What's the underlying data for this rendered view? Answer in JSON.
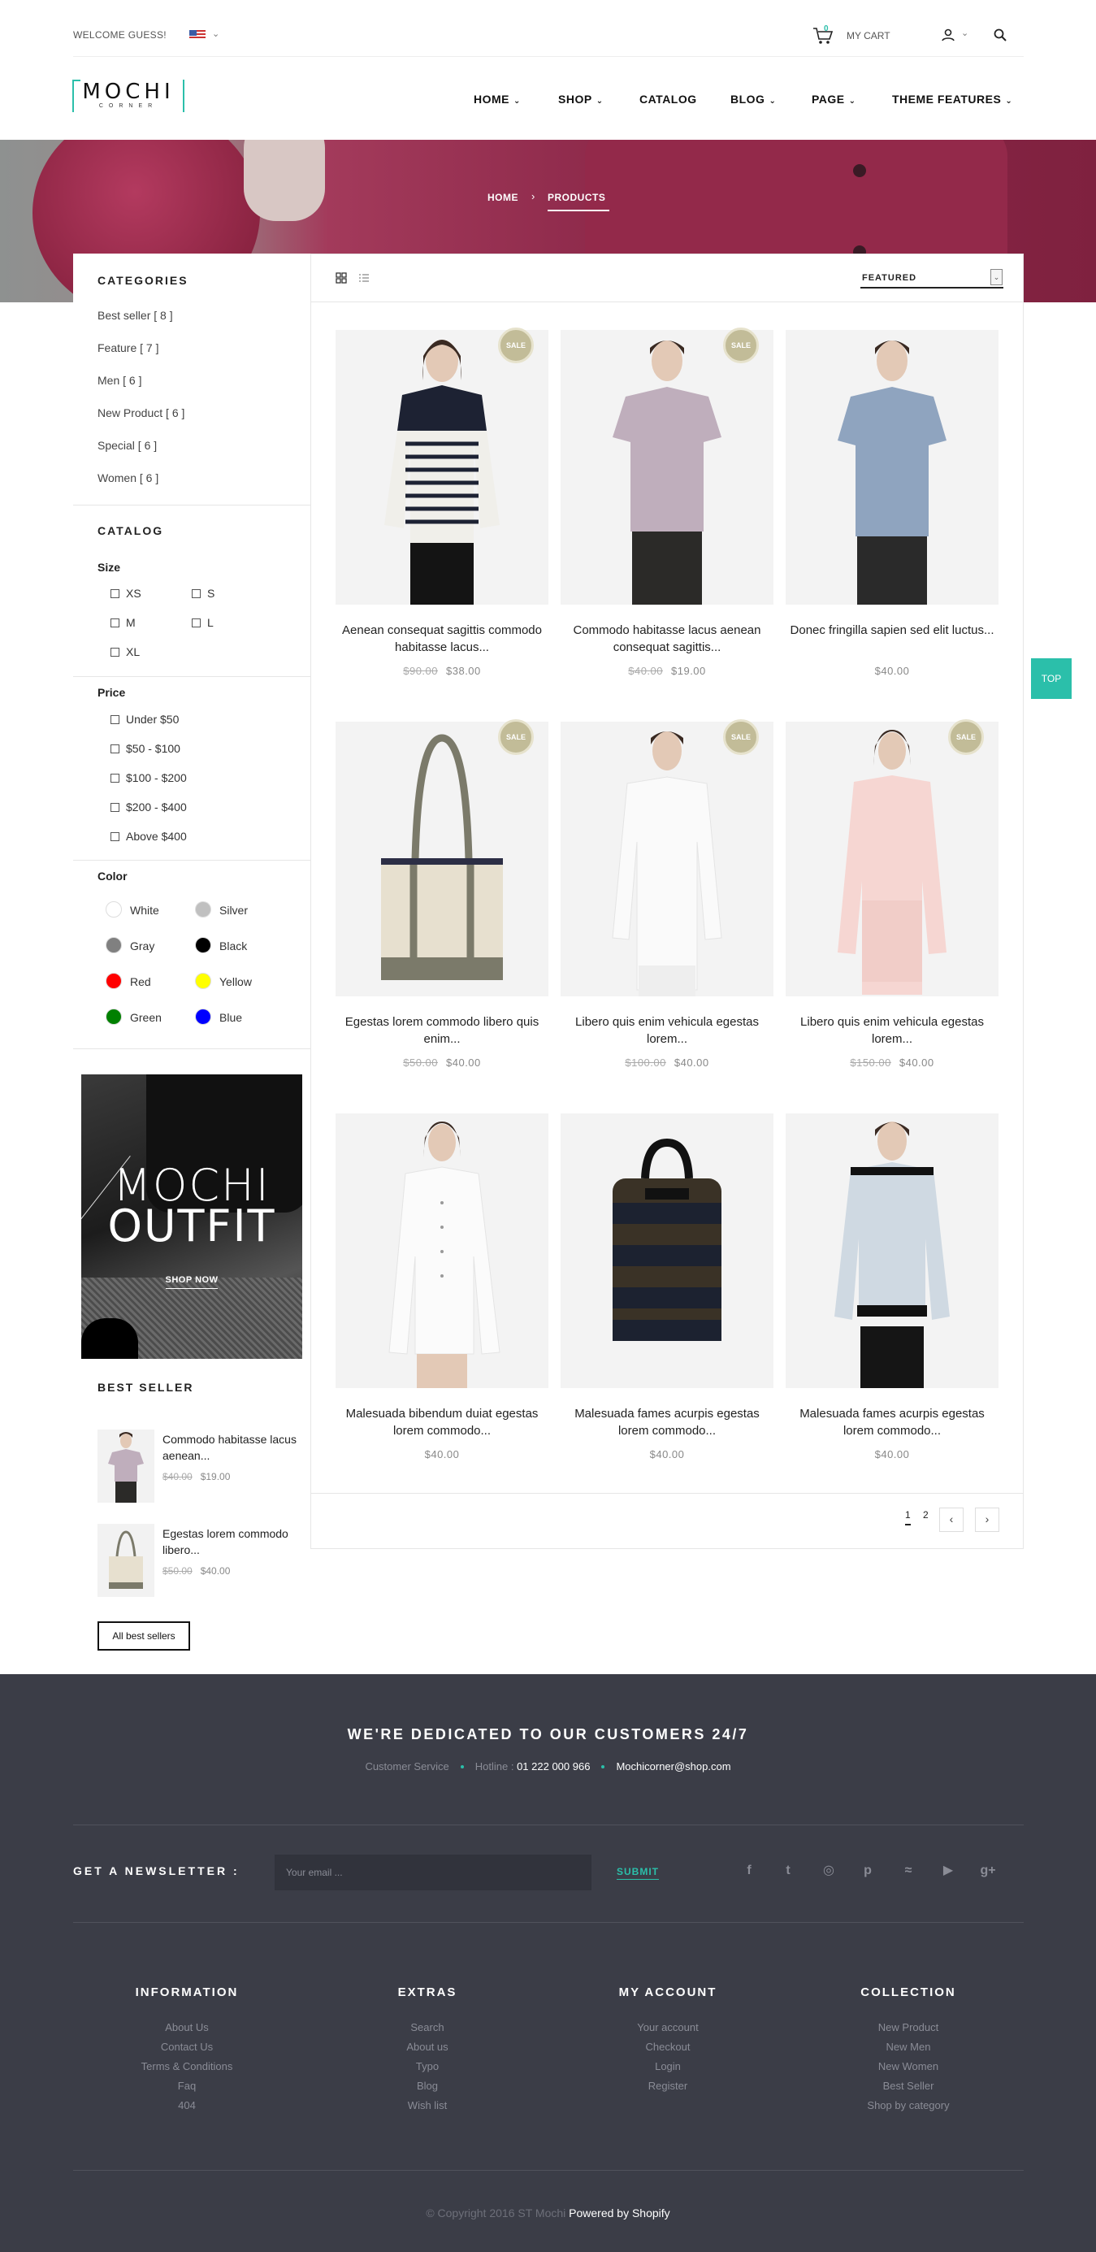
{
  "topbar": {
    "welcome": "WELCOME GUESS!",
    "cart_count": "0",
    "cart_label": "MY CART"
  },
  "logo": {
    "line1": "MOCHI",
    "line2": "CORNER"
  },
  "nav": [
    {
      "label": "HOME",
      "caret": "⌄"
    },
    {
      "label": "SHOP",
      "caret": "⌄"
    },
    {
      "label": "CATALOG",
      "caret": ""
    },
    {
      "label": "BLOG",
      "caret": "⌄"
    },
    {
      "label": "PAGE",
      "caret": "⌄"
    },
    {
      "label": "THEME FEATURES",
      "caret": "⌄"
    }
  ],
  "breadcrumb": {
    "home": "HOME",
    "sep": "›",
    "current": "PRODUCTS"
  },
  "sidebar": {
    "categories_title": "CATEGORIES",
    "categories": [
      "Best seller  [ 8 ]",
      "Feature  [ 7 ]",
      "Men  [ 6 ]",
      "New Product  [ 6 ]",
      "Special  [ 6 ]",
      "Women  [ 6 ]"
    ],
    "catalog_title": "CATALOG",
    "size_title": "Size",
    "sizes": [
      "XS",
      "S",
      "M",
      "L",
      "XL"
    ],
    "price_title": "Price",
    "prices": [
      "Under $50",
      "$50 - $100",
      "$100 - $200",
      "$200 - $400",
      "Above $400"
    ],
    "color_title": "Color",
    "colors": [
      {
        "name": "White",
        "hex": "#ffffff"
      },
      {
        "name": "Silver",
        "hex": "#c0c0c0"
      },
      {
        "name": "Gray",
        "hex": "#808080"
      },
      {
        "name": "Black",
        "hex": "#000000"
      },
      {
        "name": "Red",
        "hex": "#ff0000"
      },
      {
        "name": "Yellow",
        "hex": "#ffff00"
      },
      {
        "name": "Green",
        "hex": "#008000"
      },
      {
        "name": "Blue",
        "hex": "#0000ff"
      }
    ],
    "promo_line1": "MOCHI",
    "promo_line2": "OUTFIT",
    "promo_cta": "SHOP NOW",
    "best_seller_title": "BEST SELLER",
    "best_sellers": [
      {
        "title": "Commodo habitasse lacus aenean...",
        "old": "$40.00",
        "price": "$19.00"
      },
      {
        "title": "Egestas lorem commodo libero...",
        "old": "$50.00",
        "price": "$40.00"
      }
    ],
    "all_best_sellers": "All best sellers"
  },
  "toolbar": {
    "sort_label": "FEATURED",
    "sort_arrow": "⌄"
  },
  "products": [
    {
      "title": "Aenean consequat sagittis commodo habitasse lacus...",
      "old": "$90.00",
      "price": "$38.00",
      "sale": "SALE"
    },
    {
      "title": "Commodo habitasse lacus aenean consequat sagittis...",
      "old": "$40.00",
      "price": "$19.00",
      "sale": "SALE"
    },
    {
      "title": "Donec fringilla sapien sed elit luctus...",
      "old": "",
      "price": "$40.00",
      "sale": ""
    },
    {
      "title": "Egestas lorem commodo libero quis enim...",
      "old": "$50.00",
      "price": "$40.00",
      "sale": "SALE"
    },
    {
      "title": "Libero quis enim vehicula egestas lorem...",
      "old": "$100.00",
      "price": "$40.00",
      "sale": "SALE"
    },
    {
      "title": "Libero quis enim vehicula egestas lorem...",
      "old": "$150.00",
      "price": "$40.00",
      "sale": "SALE"
    },
    {
      "title": "Malesuada bibendum duiat egestas lorem commodo...",
      "old": "",
      "price": "$40.00",
      "sale": ""
    },
    {
      "title": "Malesuada fames acurpis egestas lorem commodo...",
      "old": "",
      "price": "$40.00",
      "sale": ""
    },
    {
      "title": "Malesuada fames acurpis egestas lorem commodo...",
      "old": "",
      "price": "$40.00",
      "sale": ""
    }
  ],
  "pager": {
    "page1": "1",
    "page2": "2",
    "prev": "‹",
    "next": "›"
  },
  "top_button": "TOP",
  "footer": {
    "headline": "WE'RE DEDICATED TO OUR CUSTOMERS 24/7",
    "service": "Customer Service",
    "hotline_label": "Hotline :",
    "hotline": "01 222 000 966",
    "email": "Mochicorner@shop.com",
    "newsletter_title": "GET A NEWSLETTER :",
    "newsletter_placeholder": "Your email ...",
    "submit": "SUBMIT",
    "social": [
      {
        "icon": "facebook-icon",
        "glyph": "f"
      },
      {
        "icon": "twitter-icon",
        "glyph": "t"
      },
      {
        "icon": "instagram-icon",
        "glyph": "◎"
      },
      {
        "icon": "pinterest-icon",
        "glyph": "p"
      },
      {
        "icon": "rss-icon",
        "glyph": "≈"
      },
      {
        "icon": "youtube-icon",
        "glyph": "▶"
      },
      {
        "icon": "google-plus-icon",
        "glyph": "g+"
      }
    ],
    "columns": [
      {
        "title": "INFORMATION",
        "items": [
          "About Us",
          "Contact Us",
          "Terms & Conditions",
          "Faq",
          "404"
        ]
      },
      {
        "title": "EXTRAS",
        "items": [
          "Search",
          "About us",
          "Typo",
          "Blog",
          "Wish list"
        ]
      },
      {
        "title": "MY ACCOUNT",
        "items": [
          "Your account",
          "Checkout",
          "Login",
          "Register"
        ]
      },
      {
        "title": "COLLECTION",
        "items": [
          "New Product",
          "New Men",
          "New Women",
          "Best Seller",
          "Shop by category"
        ]
      }
    ],
    "copyright": "© Copyright 2016 ST Mochi",
    "powered": "Powered by Shopify"
  },
  "colors": {
    "accent": "#2bbfaa",
    "footer_bg": "#3b3d47",
    "sale_badge": "#c2bc98"
  }
}
